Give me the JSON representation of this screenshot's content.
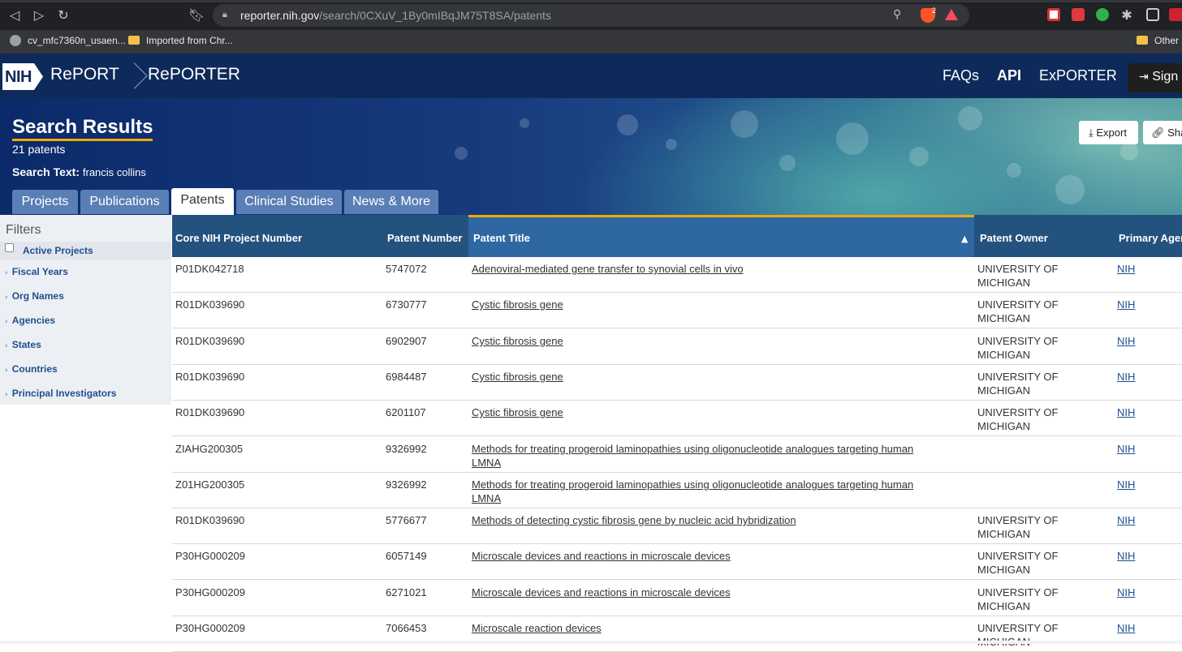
{
  "browser": {
    "url_host": "reporter.nih.gov",
    "url_path": "/search/0CXuV_1By0mIBqJM75T8SA/patents",
    "brave_count": "2",
    "bookmarks": [
      {
        "label": "cv_mfc7360n_usaen..."
      },
      {
        "label": "Imported from Chr..."
      },
      {
        "label": "Other b"
      }
    ]
  },
  "header": {
    "logo": "NIH",
    "breadcrumb_1": "RePORT",
    "breadcrumb_2": "RePORTER",
    "nav": [
      "FAQs",
      "API",
      "ExPORTER"
    ],
    "sign_in": "Sign"
  },
  "hero": {
    "title": "Search Results",
    "count": "21 patents",
    "search_text_label": "Search Text:",
    "search_text_value": "francis collins",
    "export_label": "Export",
    "share_label": "Sha"
  },
  "tabs": [
    {
      "label": "Projects"
    },
    {
      "label": "Publications"
    },
    {
      "label": "Patents"
    },
    {
      "label": "Clinical Studies"
    },
    {
      "label": "News & More"
    }
  ],
  "filters": {
    "heading": "Filters",
    "active_projects": "Active Projects",
    "items": [
      "Fiscal Years",
      "Org Names",
      "Agencies",
      "States",
      "Countries",
      "Principal Investigators"
    ]
  },
  "table": {
    "columns": [
      "Core NIH Project Number",
      "Patent Number",
      "Patent Title",
      "Patent Owner",
      "Primary Agen"
    ],
    "rows": [
      {
        "project": "P01DK042718",
        "patent": "5747072",
        "title": "Adenoviral-mediated gene transfer to synovial cells in vivo",
        "title2": "",
        "owner1": "UNIVERSITY OF",
        "owner2": "MICHIGAN",
        "agency": "NIH"
      },
      {
        "project": "R01DK039690",
        "patent": "6730777",
        "title": "Cystic fibrosis gene",
        "title2": "",
        "owner1": "UNIVERSITY OF",
        "owner2": "MICHIGAN",
        "agency": "NIH"
      },
      {
        "project": "R01DK039690",
        "patent": "6902907",
        "title": "Cystic fibrosis gene",
        "title2": "",
        "owner1": "UNIVERSITY OF",
        "owner2": "MICHIGAN",
        "agency": "NIH"
      },
      {
        "project": "R01DK039690",
        "patent": "6984487",
        "title": "Cystic fibrosis gene",
        "title2": "",
        "owner1": "UNIVERSITY OF",
        "owner2": "MICHIGAN",
        "agency": "NIH"
      },
      {
        "project": "R01DK039690",
        "patent": "6201107",
        "title": "Cystic fibrosis gene",
        "title2": "",
        "owner1": "UNIVERSITY OF",
        "owner2": "MICHIGAN",
        "agency": "NIH"
      },
      {
        "project": "ZIAHG200305",
        "patent": "9326992",
        "title": "Methods for treating progeroid laminopathies using oligonucleotide analogues targeting human",
        "title2": "LMNA",
        "owner1": "",
        "owner2": "",
        "agency": "NIH"
      },
      {
        "project": "Z01HG200305",
        "patent": "9326992",
        "title": "Methods for treating progeroid laminopathies using oligonucleotide analogues targeting human",
        "title2": "LMNA",
        "owner1": "",
        "owner2": "",
        "agency": "NIH"
      },
      {
        "project": "R01DK039690",
        "patent": "5776677",
        "title": "Methods of detecting cystic fibrosis gene by nucleic acid hybridization",
        "title2": "",
        "owner1": "UNIVERSITY OF",
        "owner2": "MICHIGAN",
        "agency": "NIH"
      },
      {
        "project": "P30HG000209",
        "patent": "6057149",
        "title": "Microscale devices and reactions in microscale devices",
        "title2": "",
        "owner1": "UNIVERSITY OF",
        "owner2": "MICHIGAN",
        "agency": "NIH"
      },
      {
        "project": "P30HG000209",
        "patent": "6271021",
        "title": "Microscale devices and reactions in microscale devices",
        "title2": "",
        "owner1": "UNIVERSITY OF",
        "owner2": "MICHIGAN",
        "agency": "NIH"
      },
      {
        "project": "P30HG000209",
        "patent": "7066453",
        "title": "Microscale reaction devices",
        "title2": "",
        "owner1": "UNIVERSITY OF",
        "owner2": "MICHIGAN",
        "agency": "NIH"
      }
    ]
  }
}
